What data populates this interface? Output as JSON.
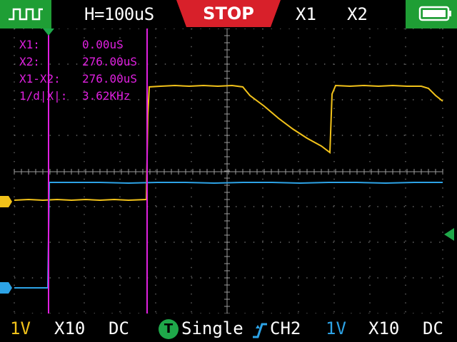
{
  "topbar": {
    "waveform_icon": "square-wave-icon",
    "timebase": "H=100uS",
    "run_state": "STOP",
    "cursor1_label": "X1",
    "cursor2_label": "X2",
    "battery_icon": "battery-icon"
  },
  "readout": {
    "x1_label": "X1:",
    "x1_value": "0.00uS",
    "x2_label": "X2:",
    "x2_value": "276.00uS",
    "delta_label": "X1-X2:",
    "delta_value": "276.00uS",
    "freq_label": "1/d|X|:",
    "freq_value": "3.62KHz"
  },
  "bottombar": {
    "ch1_volts": "1V",
    "ch1_probe": "X10",
    "ch1_coupling": "DC",
    "trigger_badge": "T",
    "trigger_mode": "Single",
    "trigger_edge_icon": "rising-edge-icon",
    "trigger_source": "CH2",
    "ch2_volts": "1V",
    "ch2_probe": "X10",
    "ch2_coupling": "DC"
  },
  "colors": {
    "ch1": "#f2c21a",
    "ch2": "#2da3e6",
    "cursor": "#e020e0",
    "accent_green": "#1f9e35",
    "stop_red": "#d8202a"
  }
}
